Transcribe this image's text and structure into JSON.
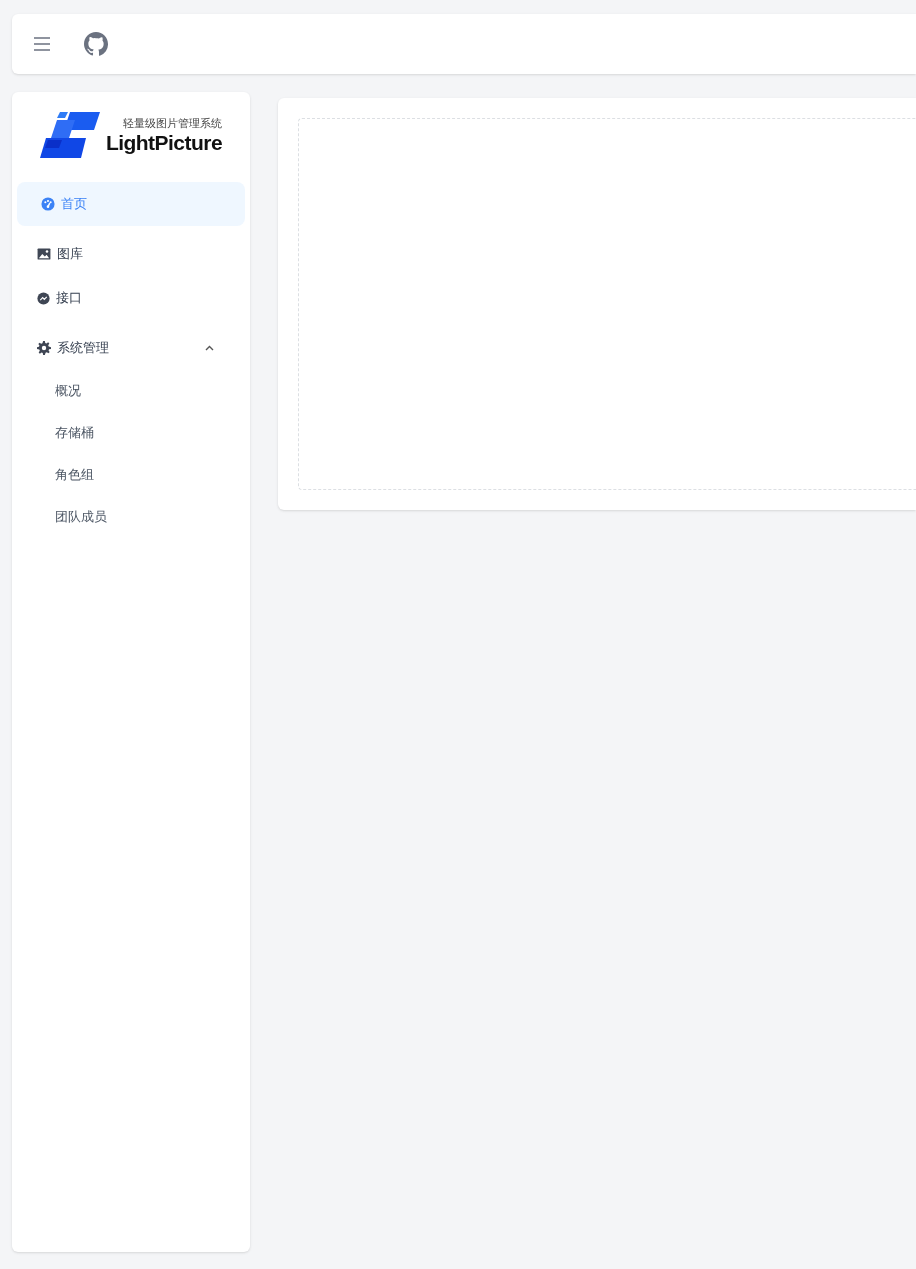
{
  "logo": {
    "subtitle": "轻量级图片管理系统",
    "name": "LightPicture"
  },
  "menu": [
    {
      "kind": "item",
      "label": "首页",
      "selected": true
    },
    {
      "kind": "item",
      "label": "图库",
      "selected": false
    },
    {
      "kind": "item",
      "label": "接口",
      "selected": false
    },
    {
      "kind": "group",
      "label": "系统管理",
      "selected": false,
      "expanded": true,
      "children": [
        {
          "label": "概况",
          "selected": false
        },
        {
          "label": "存储桶",
          "selected": false
        },
        {
          "label": "角色组",
          "selected": false
        },
        {
          "label": "团队成员",
          "selected": false
        }
      ]
    }
  ]
}
